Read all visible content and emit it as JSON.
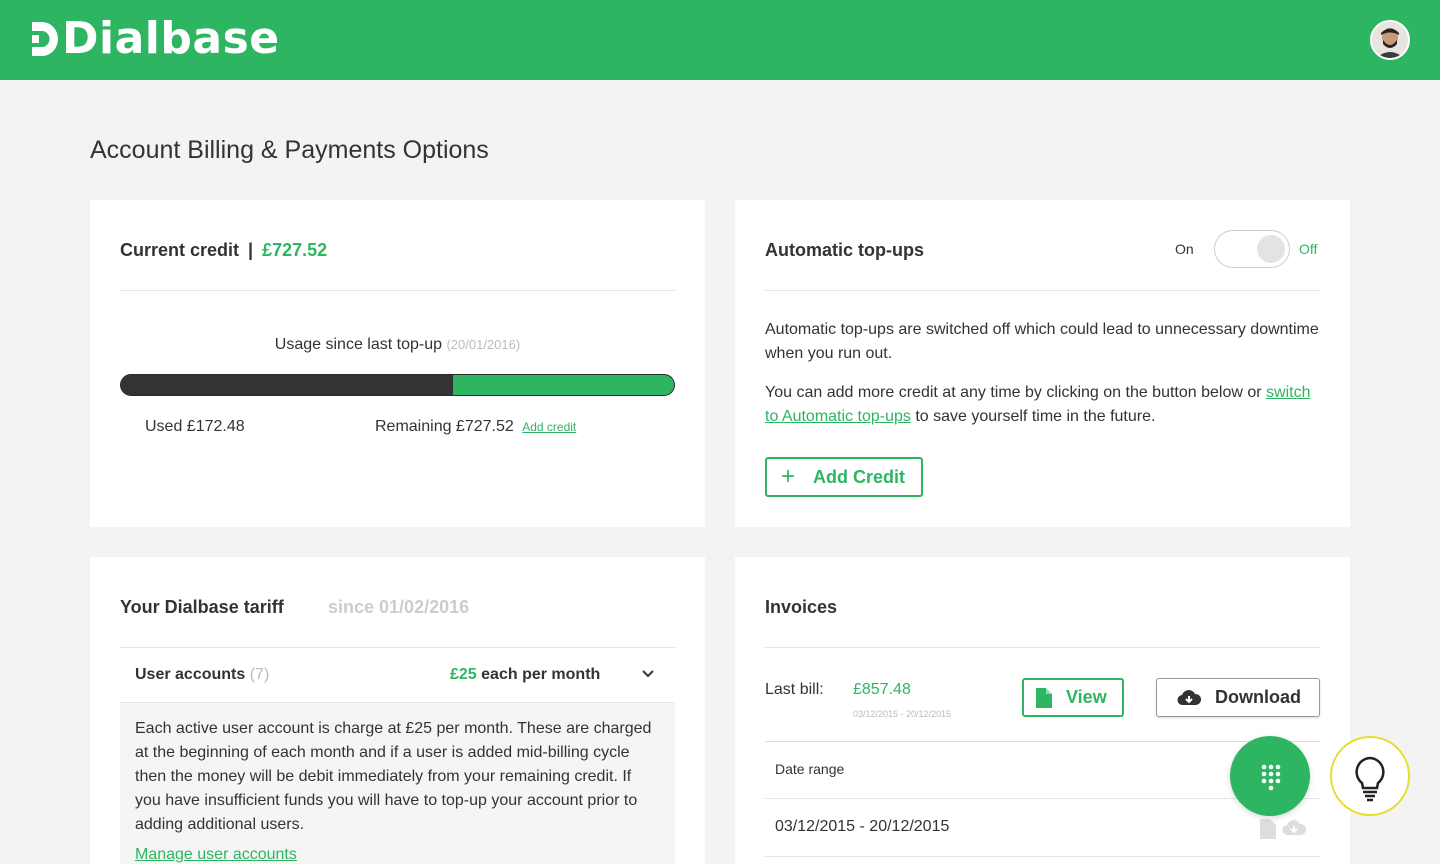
{
  "header": {
    "brand": "Dialbase",
    "avatar_icon": "user-avatar"
  },
  "page": {
    "title": "Account Billing & Payments Options"
  },
  "credit": {
    "title": "Current credit",
    "separator": "|",
    "amount": "£727.52",
    "usage_label": "Usage since last top-up",
    "usage_date": "(20/01/2016)",
    "used_fraction": 0.6,
    "used_label": "Used £172.48",
    "remaining_label": "Remaining £727.52",
    "add_credit_link": "Add credit"
  },
  "auto_topups": {
    "title": "Automatic top-ups",
    "toggle_on_label": "On",
    "toggle_off_label": "Off",
    "toggle_state": "off",
    "p1": "Automatic top-ups are switched off which could lead to unnecessary downtime when you run out.",
    "p2_before": "You can add more credit at any time by clicking on the button below or",
    "p2_link": "switch to Automatic top-ups",
    "p2_after": "to save yourself time in the future.",
    "button_label": "Add Credit",
    "button_icon": "plus-icon"
  },
  "tariff": {
    "title": "Your Dialbase tariff",
    "since": "since 01/02/2016",
    "row_label": "User accounts",
    "row_count": "(7)",
    "price": "£25",
    "price_suffix": "each per month",
    "description": "Each active user account is charge at £25 per month. These are charged at the beginning of each month and if a user is added mid-billing cycle then the money will be debit immediately from your remaining credit. If you have insufficient funds you will have to top-up your account prior to adding additional users.",
    "manage_link": "Manage user accounts"
  },
  "invoices": {
    "title": "Invoices",
    "last_bill_label": "Last bill:",
    "last_bill_amount": "£857.48",
    "last_bill_range": "03/12/2015 - 20/12/2015",
    "view_label": "View",
    "download_label": "Download",
    "column_header": "Date range",
    "rows": [
      {
        "range": "03/12/2015 - 20/12/2015"
      }
    ]
  },
  "colors": {
    "brand_green": "#2db562",
    "dark": "#333333",
    "tips_ring": "#e6dd2c"
  }
}
